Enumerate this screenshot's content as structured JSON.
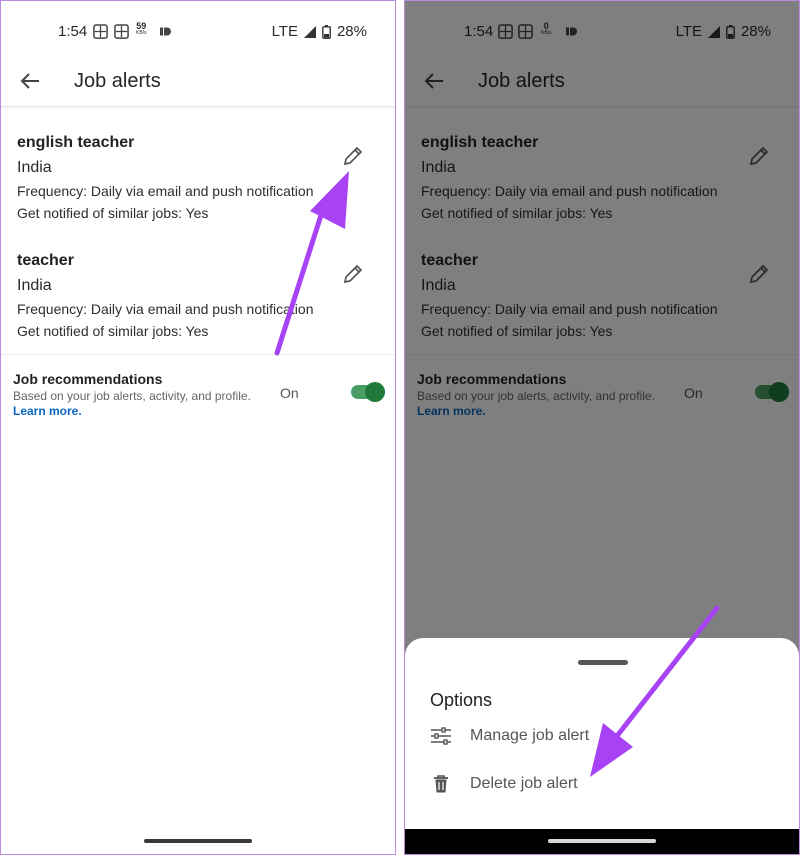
{
  "left": {
    "status": {
      "time": "1:54",
      "speed": "59",
      "speed_unit": "KB/s",
      "network": "LTE",
      "battery": "28%"
    },
    "title": "Job alerts",
    "alerts": [
      {
        "name": "english teacher",
        "location": "India",
        "frequency": "Frequency: Daily via email and push notification",
        "similar": "Get notified of similar jobs: Yes"
      },
      {
        "name": "teacher",
        "location": "India",
        "frequency": "Frequency: Daily via email and push notification",
        "similar": "Get notified of similar jobs: Yes"
      }
    ],
    "recommendations": {
      "title": "Job recommendations",
      "subtitle": "Based on your job alerts, activity, and profile.",
      "link": "Learn more.",
      "state": "On"
    }
  },
  "right": {
    "status": {
      "time": "1:54",
      "speed": "0",
      "speed_unit": "KB/s",
      "network": "LTE",
      "battery": "28%"
    },
    "title": "Job alerts",
    "alerts": [
      {
        "name": "english teacher",
        "location": "India",
        "frequency": "Frequency: Daily via email and push notification",
        "similar": "Get notified of similar jobs: Yes"
      },
      {
        "name": "teacher",
        "location": "India",
        "frequency": "Frequency: Daily via email and push notification",
        "similar": "Get notified of similar jobs: Yes"
      }
    ],
    "recommendations": {
      "title": "Job recommendations",
      "subtitle": "Based on your job alerts, activity, and profile.",
      "link": "Learn more.",
      "state": "On"
    },
    "sheet": {
      "title": "Options",
      "options": [
        {
          "label": "Manage job alert",
          "icon": "sliders-icon"
        },
        {
          "label": "Delete job alert",
          "icon": "trash-icon"
        }
      ]
    }
  },
  "colors": {
    "toggle_on": "#1f7a3b",
    "link": "#0a66c2",
    "annotation_arrow": "#a742f5"
  }
}
